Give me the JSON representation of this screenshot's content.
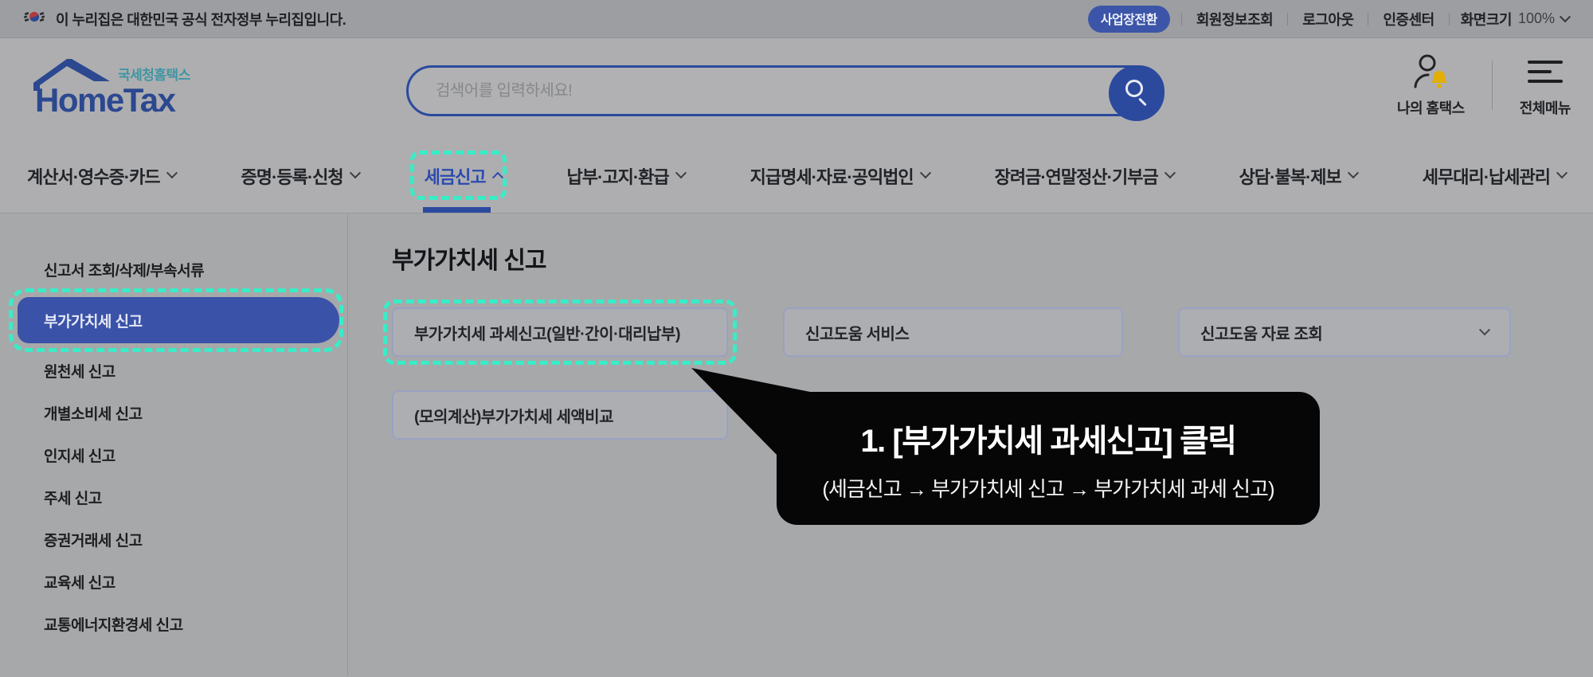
{
  "colors": {
    "accent_blue": "#2b4a9e",
    "selected_pill_blue": "#3a53a8",
    "highlight_teal": "#37edc7",
    "bell_yellow": "#e2ae07",
    "logo_teal": "#3f96a4",
    "callout_black": "#060606"
  },
  "topbar": {
    "notice": "이 누리집은 대한민국 공식 전자정부 누리집입니다.",
    "badge": "사업장전환",
    "links": [
      "회원정보조회",
      "로그아웃",
      "인증센터"
    ],
    "zoom_label": "화면크기",
    "zoom_value": "100%"
  },
  "header": {
    "logo_sub": "국세청홈택스",
    "logo_main": "HomeTax",
    "search_placeholder": "검색어를 입력하세요!",
    "my_hometax": "나의 홈택스",
    "all_menu": "전체메뉴"
  },
  "nav": {
    "items": [
      {
        "label": "계산서·영수증·카드",
        "active": false
      },
      {
        "label": "증명·등록·신청",
        "active": false
      },
      {
        "label": "세금신고",
        "active": true
      },
      {
        "label": "납부·고지·환급",
        "active": false
      },
      {
        "label": "지급명세·자료·공익법인",
        "active": false
      },
      {
        "label": "장려금·연말정산·기부금",
        "active": false
      },
      {
        "label": "상담·불복·제보",
        "active": false
      },
      {
        "label": "세무대리·납세관리",
        "active": false
      }
    ]
  },
  "sidebar": {
    "items": [
      {
        "label": "신고서 조회/삭제/부속서류",
        "selected": false
      },
      {
        "label": "부가가치세 신고",
        "selected": true
      },
      {
        "label": "원천세 신고",
        "selected": false
      },
      {
        "label": "개별소비세 신고",
        "selected": false
      },
      {
        "label": "인지세 신고",
        "selected": false
      },
      {
        "label": "주세 신고",
        "selected": false
      },
      {
        "label": "증권거래세 신고",
        "selected": false
      },
      {
        "label": "교육세 신고",
        "selected": false
      },
      {
        "label": "교통에너지환경세 신고",
        "selected": false
      }
    ]
  },
  "main": {
    "title": "부가가치세 신고",
    "cards": [
      {
        "label": "부가가치세 과세신고(일반·간이·대리납부)",
        "highlighted": true
      },
      {
        "label": "신고도움 서비스",
        "highlighted": false
      },
      {
        "label": "신고도움 자료 조회",
        "dropdown": true,
        "highlighted": false
      },
      {
        "label": "(모의계산)부가가치세 세액비교",
        "highlighted": false
      }
    ]
  },
  "callout": {
    "line1": "1. [부가가치세 과세신고] 클릭",
    "line2": "(세금신고 → 부가가치세 신고 → 부가가치세 과세 신고)"
  }
}
